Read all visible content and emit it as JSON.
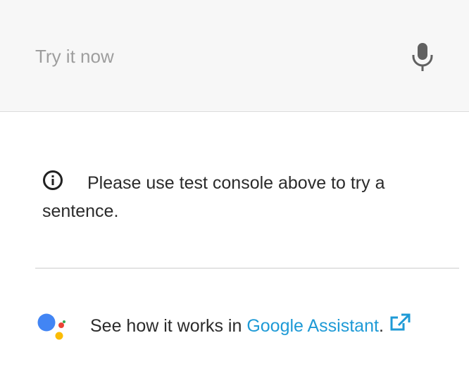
{
  "try_bar": {
    "placeholder": "Try it now",
    "mic_icon": "microphone-icon"
  },
  "info": {
    "icon": "info-icon",
    "message": "Please use test console above to try a sentence."
  },
  "assistant": {
    "logo_icon": "google-assistant-icon",
    "prefix": "See how it works in ",
    "link_text": "Google Assistant",
    "suffix": ".",
    "external_icon": "external-link-icon"
  },
  "colors": {
    "bar_background": "#f7f7f7",
    "link": "#1e9ad6",
    "assistant_blue": "#4285f4",
    "assistant_red": "#ea4335",
    "assistant_yellow": "#fbbc05",
    "assistant_green": "#34a853"
  }
}
